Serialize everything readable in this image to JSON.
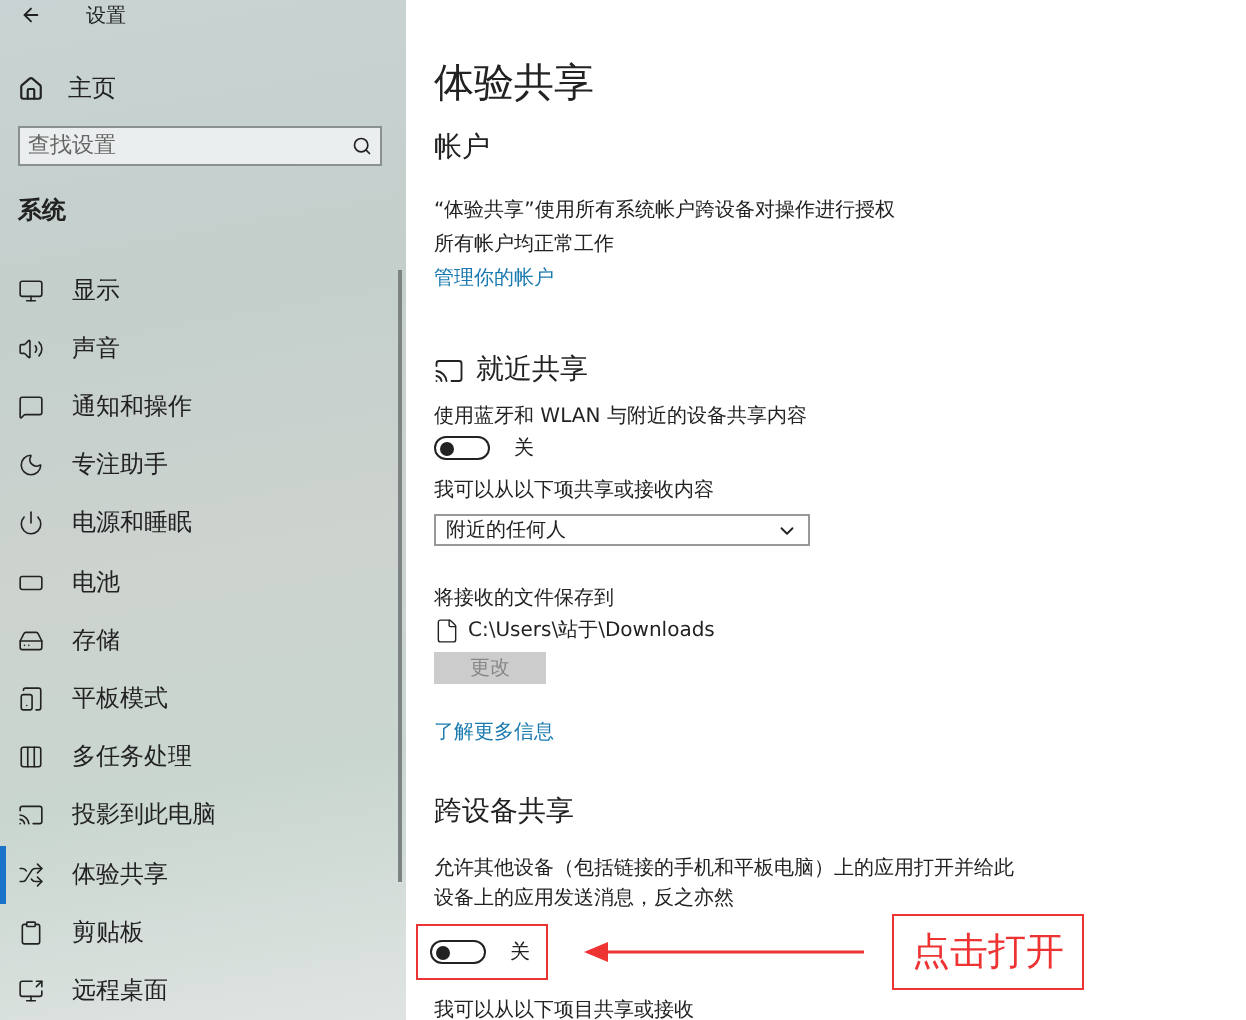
{
  "window": {
    "title": "设置"
  },
  "sidebar": {
    "home": "主页",
    "search": {
      "placeholder": "查找设置"
    },
    "section": "系统",
    "items": [
      {
        "label": "显示",
        "selected": false
      },
      {
        "label": "声音",
        "selected": false
      },
      {
        "label": "通知和操作",
        "selected": false
      },
      {
        "label": "专注助手",
        "selected": false
      },
      {
        "label": "电源和睡眠",
        "selected": false
      },
      {
        "label": "电池",
        "selected": false
      },
      {
        "label": "存储",
        "selected": false
      },
      {
        "label": "平板模式",
        "selected": false
      },
      {
        "label": "多任务处理",
        "selected": false
      },
      {
        "label": "投影到此电脑",
        "selected": false
      },
      {
        "label": "体验共享",
        "selected": true
      },
      {
        "label": "剪贴板",
        "selected": false
      },
      {
        "label": "远程桌面",
        "selected": false
      }
    ]
  },
  "page": {
    "title": "体验共享",
    "account": {
      "heading": "帐户",
      "lines": [
        "“体验共享”使用所有系统帐户跨设备对操作进行授权",
        "所有帐户均正常工作"
      ],
      "link": "管理你的帐户"
    },
    "nearby": {
      "heading": "就近共享",
      "description": "使用蓝牙和 WLAN 与附近的设备共享内容",
      "toggle": {
        "on": false,
        "label": "关"
      },
      "share_label": "我可以从以下项共享或接收内容",
      "dropdown": {
        "value": "附近的任何人"
      },
      "save_label": "将接收的文件保存到",
      "path": "C:\\Users\\站于\\Downloads",
      "change_button": {
        "label": "更改",
        "disabled": true
      },
      "link": "了解更多信息"
    },
    "cross_device": {
      "heading": "跨设备共享",
      "description": "允许其他设备（包括链接的手机和平板电脑）上的应用打开并给此设备上的应用发送消息，反之亦然",
      "toggle": {
        "on": false,
        "label": "关"
      },
      "callout": "点击打开",
      "share_label": "我可以从以下项目共享或接收"
    }
  }
}
